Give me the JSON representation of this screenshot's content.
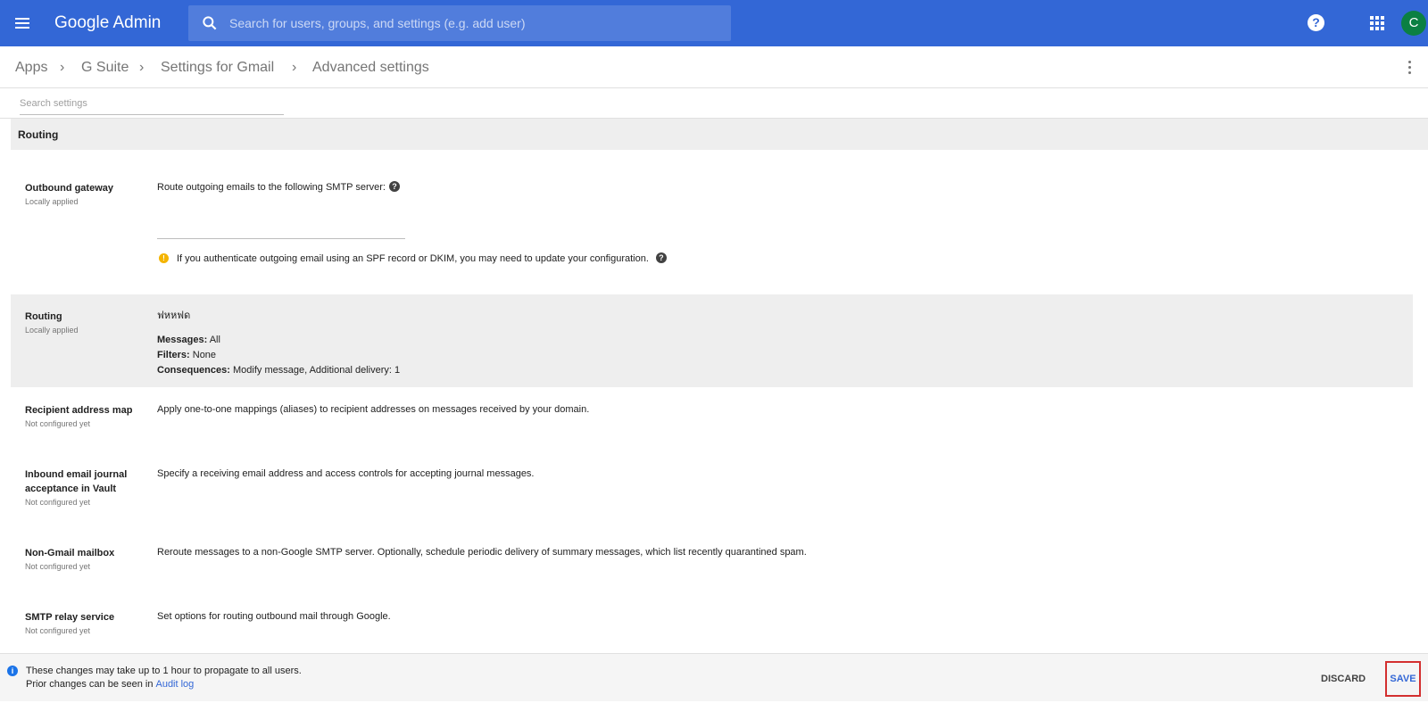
{
  "header": {
    "app_name": "Google Admin",
    "search_placeholder": "Search for users, groups, and settings (e.g. add user)",
    "help_label": "?",
    "avatar_initial": "C"
  },
  "breadcrumb": [
    "Apps",
    "G Suite",
    "Settings for Gmail",
    "Advanced settings"
  ],
  "search_settings_placeholder": "Search settings",
  "section": {
    "title": "Routing"
  },
  "settings": {
    "outbound_gateway": {
      "title": "Outbound gateway",
      "status": "Locally applied",
      "description": "Route outgoing emails to the following SMTP server:",
      "smtp_value": "",
      "warning": "If you authenticate outgoing email using an SPF record or DKIM, you may need to update your configuration."
    },
    "routing": {
      "title": "Routing",
      "status": "Locally applied",
      "rule_name": "ฟหหฟด",
      "messages_label": "Messages:",
      "messages_value": "All",
      "filters_label": "Filters:",
      "filters_value": "None",
      "consequences_label": "Consequences:",
      "consequences_value": "Modify message, Additional delivery: 1"
    },
    "recipient_address_map": {
      "title": "Recipient address map",
      "status": "Not configured yet",
      "description": "Apply one-to-one mappings (aliases) to recipient addresses on messages received by your domain."
    },
    "inbound_journal": {
      "title": "Inbound email journal acceptance in Vault",
      "status": "Not configured yet",
      "description": "Specify a receiving email address and access controls for accepting journal messages."
    },
    "non_gmail_mailbox": {
      "title": "Non-Gmail mailbox",
      "status": "Not configured yet",
      "description": "Reroute messages to a non-Google SMTP server. Optionally, schedule periodic delivery of summary messages, which list recently quarantined spam."
    },
    "smtp_relay": {
      "title": "SMTP relay service",
      "status": "Not configured yet",
      "description": "Set options for routing outbound mail through Google."
    }
  },
  "footer": {
    "message_line1": "These changes may take up to 1 hour to propagate to all users.",
    "message_line2": "Prior changes can be seen in",
    "audit_link": "Audit log",
    "discard_label": "DISCARD",
    "save_label": "SAVE"
  },
  "colors": {
    "brand_blue": "#3367d6",
    "avatar_green": "#0b8043",
    "save_highlight": "#d32f2f",
    "warning_yellow": "#f4b400"
  },
  "icons": [
    "menu-icon",
    "search-icon",
    "help-icon",
    "apps-grid-icon",
    "more-vert-icon",
    "help-circle-icon",
    "warning-icon",
    "info-icon"
  ]
}
